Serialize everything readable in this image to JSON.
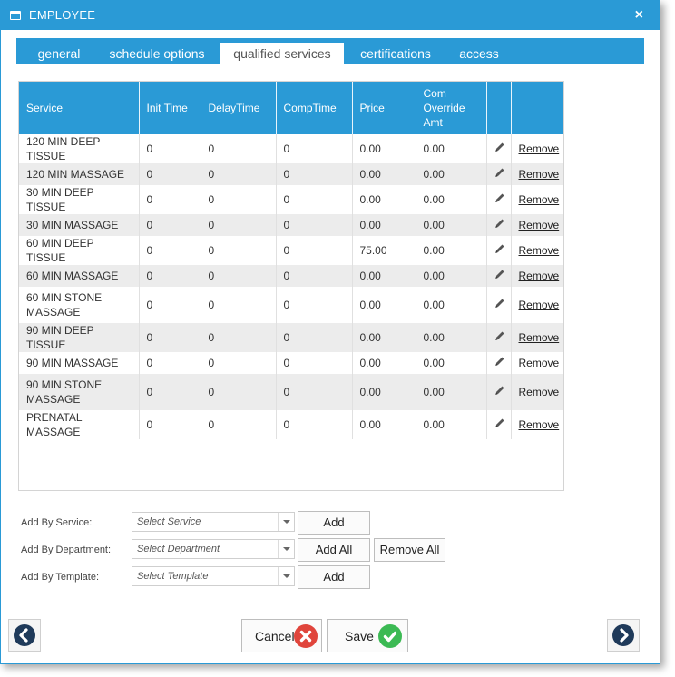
{
  "window": {
    "title": "EMPLOYEE",
    "close_label": "×"
  },
  "tabs": [
    {
      "label": "general"
    },
    {
      "label": "schedule options"
    },
    {
      "label": "qualified services"
    },
    {
      "label": "certifications"
    },
    {
      "label": "access"
    }
  ],
  "active_tab": "qualified services",
  "grid": {
    "columns": [
      "Service",
      "Init Time",
      "DelayTime",
      "CompTime",
      "Price",
      "Com Override Amt",
      "",
      ""
    ],
    "remove_label": "Remove",
    "rows": [
      {
        "service": "120 MIN DEEP TISSUE",
        "init": "0",
        "delay": "0",
        "comp": "0",
        "price": "0.00",
        "override": "0.00"
      },
      {
        "service": "120 MIN MASSAGE",
        "init": "0",
        "delay": "0",
        "comp": "0",
        "price": "0.00",
        "override": "0.00"
      },
      {
        "service": "30 MIN DEEP TISSUE",
        "init": "0",
        "delay": "0",
        "comp": "0",
        "price": "0.00",
        "override": "0.00"
      },
      {
        "service": "30 MIN MASSAGE",
        "init": "0",
        "delay": "0",
        "comp": "0",
        "price": "0.00",
        "override": "0.00"
      },
      {
        "service": "60 MIN DEEP TISSUE",
        "init": "0",
        "delay": "0",
        "comp": "0",
        "price": "75.00",
        "override": "0.00"
      },
      {
        "service": "60 MIN MASSAGE",
        "init": "0",
        "delay": "0",
        "comp": "0",
        "price": "0.00",
        "override": "0.00"
      },
      {
        "service": "60 MIN STONE MASSAGE",
        "init": "0",
        "delay": "0",
        "comp": "0",
        "price": "0.00",
        "override": "0.00"
      },
      {
        "service": "90 MIN DEEP TISSUE",
        "init": "0",
        "delay": "0",
        "comp": "0",
        "price": "0.00",
        "override": "0.00"
      },
      {
        "service": "90 MIN MASSAGE",
        "init": "0",
        "delay": "0",
        "comp": "0",
        "price": "0.00",
        "override": "0.00"
      },
      {
        "service": "90 MIN STONE MASSAGE",
        "init": "0",
        "delay": "0",
        "comp": "0",
        "price": "0.00",
        "override": "0.00"
      },
      {
        "service": "PRENATAL MASSAGE",
        "init": "0",
        "delay": "0",
        "comp": "0",
        "price": "0.00",
        "override": "0.00"
      }
    ]
  },
  "add_by_service": {
    "label": "Add By Service:",
    "placeholder": "Select Service",
    "add_label": "Add"
  },
  "add_by_department": {
    "label": "Add By Department:",
    "placeholder": "Select Department",
    "add_all_label": "Add All",
    "remove_all_label": "Remove All"
  },
  "add_by_template": {
    "label": "Add By Template:",
    "placeholder": "Select Template",
    "add_label": "Add"
  },
  "footer": {
    "cancel_label": "Cancel",
    "save_label": "Save"
  },
  "colors": {
    "accent": "#2a9ad6",
    "cancel": "#e0453c",
    "save": "#3cba54",
    "nav": "#1f3a5a"
  },
  "icons": {
    "window": "window-icon",
    "edit": "pencil-icon",
    "cancel": "x-circle-icon",
    "save": "check-circle-icon",
    "prev": "chevron-left-icon",
    "next": "chevron-right-icon"
  }
}
